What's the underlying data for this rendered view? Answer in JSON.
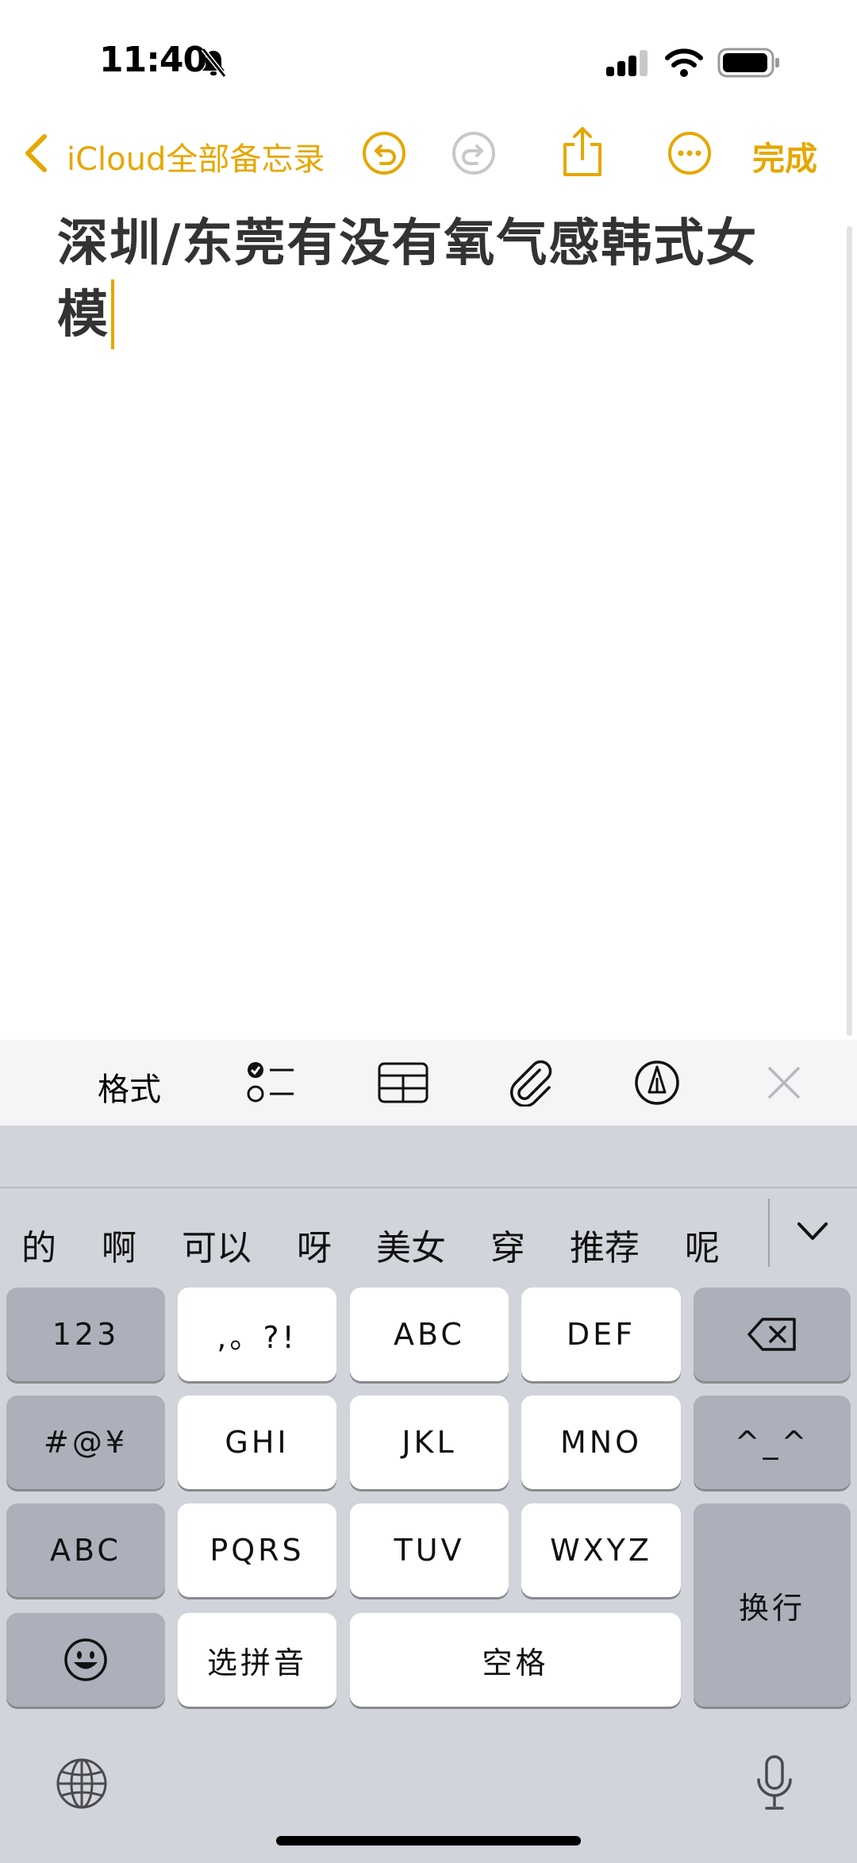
{
  "status_bar": {
    "time": "11:40"
  },
  "nav": {
    "back_label": "iCloud全部备忘录",
    "done_label": "完成"
  },
  "note": {
    "title_text": "深圳/东莞有没有氧气感韩式女模"
  },
  "format_toolbar": {
    "format_label": "格式"
  },
  "keyboard": {
    "candidates": [
      "的",
      "啊",
      "可以",
      "呀",
      "美女",
      "穿",
      "推荐",
      "呢"
    ],
    "keys": {
      "numbers": "123",
      "punct": ",。?!",
      "abc": "ABC",
      "def": "DEF",
      "symbols": "#@¥",
      "ghi": "GHI",
      "jkl": "JKL",
      "mno": "MNO",
      "emoticon": "^_^",
      "abc_switch": "ABC",
      "pqrs": "PQRS",
      "tuv": "TUV",
      "wxyz": "WXYZ",
      "return": "换行",
      "pinyin": "选拼音",
      "space": "空格"
    }
  },
  "colors": {
    "accent": "#e6a700",
    "keyboard_bg": "#d1d4da"
  }
}
